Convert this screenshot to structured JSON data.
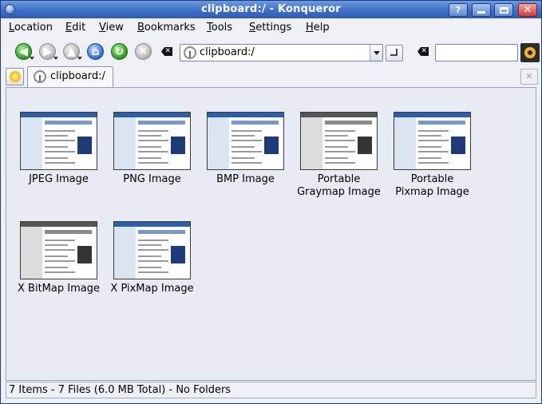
{
  "window": {
    "title": "clipboard:/ - Konqueror"
  },
  "titlebar": {
    "help": "?",
    "minimize": "",
    "maximize": "",
    "close": ""
  },
  "menu": [
    {
      "label": "Location",
      "mnemonic": "L"
    },
    {
      "label": "Edit",
      "mnemonic": "E"
    },
    {
      "label": "View",
      "mnemonic": "V"
    },
    {
      "label": "Bookmarks",
      "mnemonic": "B"
    },
    {
      "label": "Tools",
      "mnemonic": "T"
    },
    {
      "label": "Settings",
      "mnemonic": "S"
    },
    {
      "label": "Help",
      "mnemonic": "H"
    }
  ],
  "toolbar": {
    "back_icon": "back-arrow-icon",
    "forward_icon": "forward-arrow-icon",
    "up_icon": "up-arrow-icon",
    "home_icon": "home-icon",
    "reload_icon": "reload-icon",
    "stop_icon": "stop-icon",
    "url_value": "clipboard:/",
    "search_value": ""
  },
  "tabs": [
    {
      "label": "clipboard:/"
    }
  ],
  "files": [
    {
      "label_lines": [
        "JPEG Image"
      ],
      "grey": false
    },
    {
      "label_lines": [
        "PNG Image"
      ],
      "grey": false
    },
    {
      "label_lines": [
        "BMP Image"
      ],
      "grey": false
    },
    {
      "label_lines": [
        "Portable",
        "Graymap Image"
      ],
      "grey": true
    },
    {
      "label_lines": [
        "Portable",
        "Pixmap Image"
      ],
      "grey": false
    },
    {
      "label_lines": [
        "X BitMap Image"
      ],
      "grey": true
    },
    {
      "label_lines": [
        "X PixMap Image"
      ],
      "grey": false
    }
  ],
  "status": {
    "text": "7 Items - 7 Files (6.0 MB Total) - No Folders"
  },
  "colors": {
    "titlebar": "#3f6fc6",
    "background": "#e9ebf4"
  }
}
